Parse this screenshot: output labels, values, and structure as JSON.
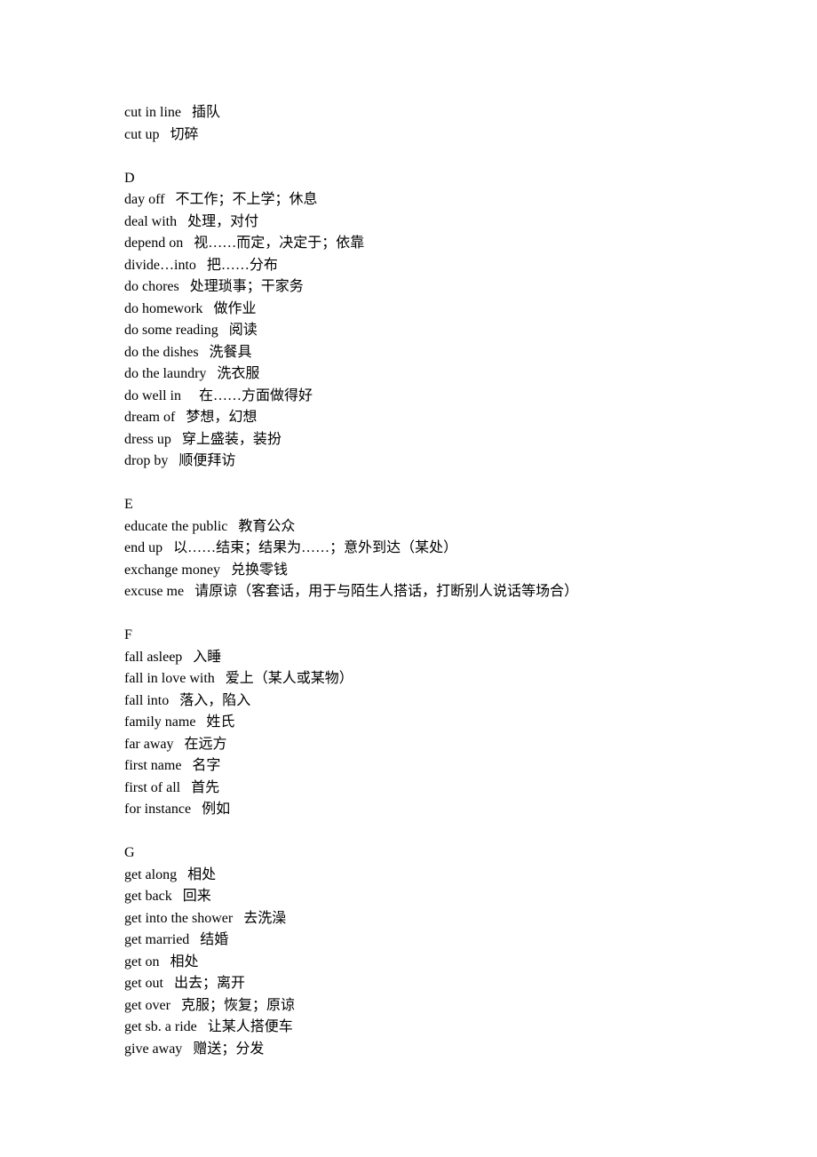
{
  "sections": [
    {
      "header": null,
      "entries": [
        {
          "en": "cut in line",
          "zh": "插队"
        },
        {
          "en": "cut up",
          "zh": "切碎"
        }
      ]
    },
    {
      "header": "D",
      "entries": [
        {
          "en": "day off",
          "zh": "不工作；不上学；休息"
        },
        {
          "en": "deal with",
          "zh": "处理，对付"
        },
        {
          "en": "depend on",
          "zh": "视……而定，决定于；依靠"
        },
        {
          "en": "divide…into",
          "zh": "把……分布"
        },
        {
          "en": "do chores",
          "zh": "处理琐事；干家务"
        },
        {
          "en": "do homework",
          "zh": "做作业"
        },
        {
          "en": "do some reading",
          "zh": "阅读"
        },
        {
          "en": "do the dishes",
          "zh": "洗餐具"
        },
        {
          "en": "do the laundry",
          "zh": "洗衣服"
        },
        {
          "en": "do well in  ",
          "zh": "在……方面做得好"
        },
        {
          "en": "dream of",
          "zh": "梦想，幻想"
        },
        {
          "en": "dress up",
          "zh": "穿上盛装，装扮"
        },
        {
          "en": "drop by",
          "zh": "顺便拜访"
        }
      ]
    },
    {
      "header": "E",
      "entries": [
        {
          "en": "educate the public",
          "zh": "教育公众"
        },
        {
          "en": "end up",
          "zh": "以……结束；结果为……；意外到达（某处）"
        },
        {
          "en": "exchange money",
          "zh": "兑换零钱"
        },
        {
          "en": "excuse me",
          "zh": "请原谅（客套话，用于与陌生人搭话，打断别人说话等场合）"
        }
      ]
    },
    {
      "header": "F",
      "entries": [
        {
          "en": "fall asleep",
          "zh": "入睡"
        },
        {
          "en": "fall in love with",
          "zh": "爱上（某人或某物）"
        },
        {
          "en": "fall into",
          "zh": "落入，陷入"
        },
        {
          "en": "family name",
          "zh": "姓氏"
        },
        {
          "en": "far away",
          "zh": "在远方"
        },
        {
          "en": "first name",
          "zh": "名字"
        },
        {
          "en": "first of all",
          "zh": "首先"
        },
        {
          "en": "for instance",
          "zh": "例如"
        }
      ]
    },
    {
      "header": "G",
      "entries": [
        {
          "en": "get along",
          "zh": "相处"
        },
        {
          "en": "get back",
          "zh": "回来"
        },
        {
          "en": "get into the shower",
          "zh": "去洗澡"
        },
        {
          "en": "get married",
          "zh": "结婚"
        },
        {
          "en": "get on",
          "zh": "相处"
        },
        {
          "en": "get out",
          "zh": "出去；离开"
        },
        {
          "en": "get over",
          "zh": "克服；恢复；原谅"
        },
        {
          "en": "get sb. a ride",
          "zh": "让某人搭便车"
        },
        {
          "en": "give away",
          "zh": "赠送；分发"
        }
      ]
    }
  ]
}
